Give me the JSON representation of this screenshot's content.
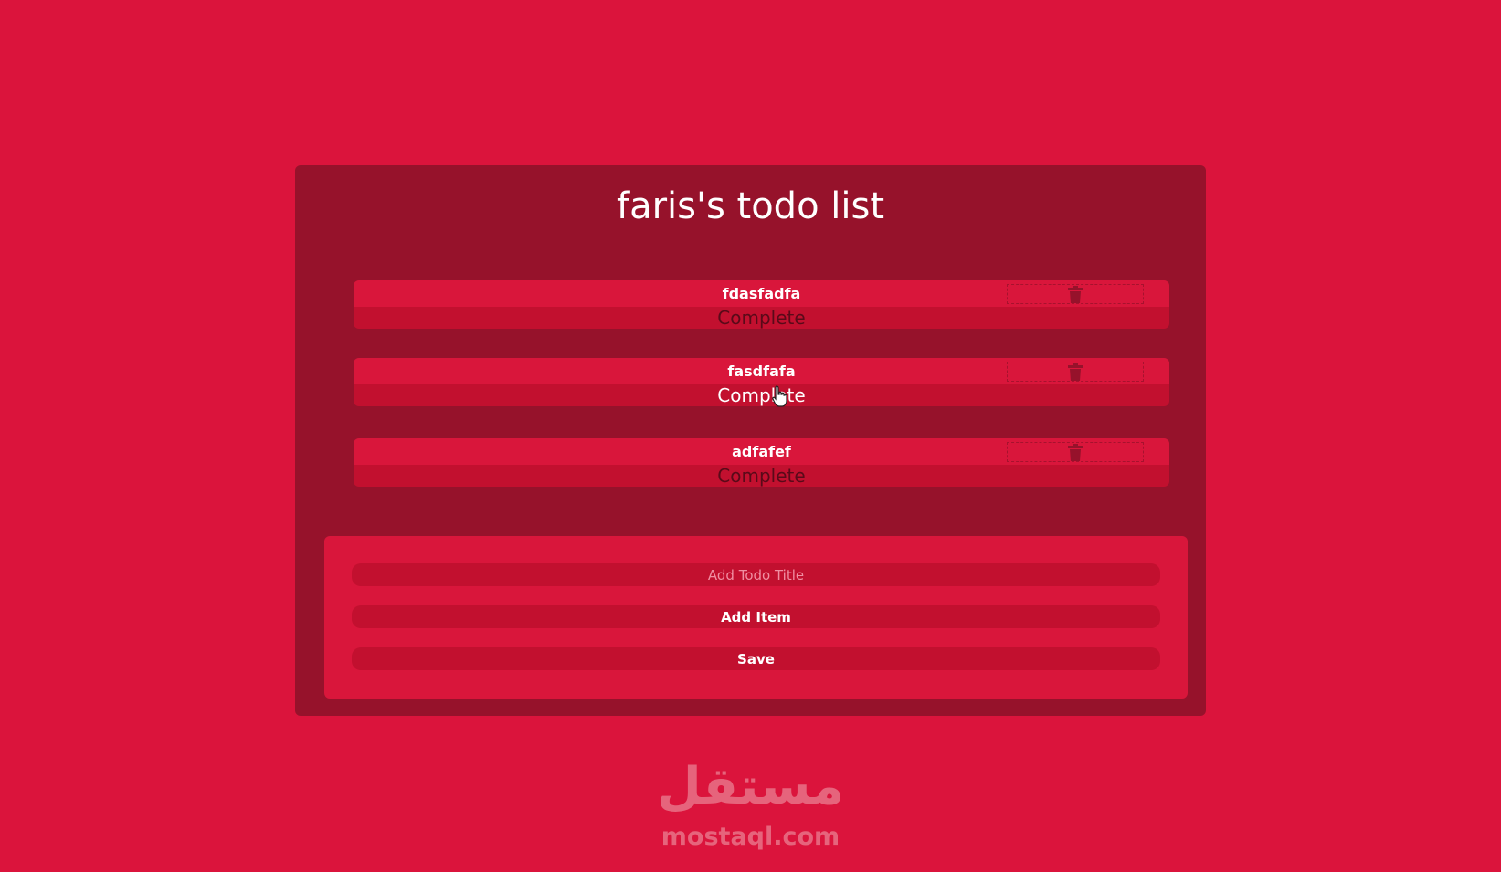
{
  "app": {
    "title": "faris's todo list"
  },
  "todos": [
    {
      "name": "fdasfadfa",
      "action_label": "Complete"
    },
    {
      "name": "fasdfafa",
      "action_label": "Complete"
    },
    {
      "name": "adfafef",
      "action_label": "Complete"
    }
  ],
  "form": {
    "title_placeholder": "Add Todo Title",
    "add_item_label": "Add Item",
    "save_label": "Save"
  },
  "icons": {
    "delete": "trash-icon",
    "cursor": "pointer-hand-icon"
  },
  "watermark": {
    "arabic": "مستقل",
    "latin": "mostaql.com"
  },
  "colors": {
    "background": "#db143c",
    "panel": "#96122b",
    "item_top": "#d9163b",
    "item_bottom": "#c2102f",
    "text": "#ffffff"
  }
}
